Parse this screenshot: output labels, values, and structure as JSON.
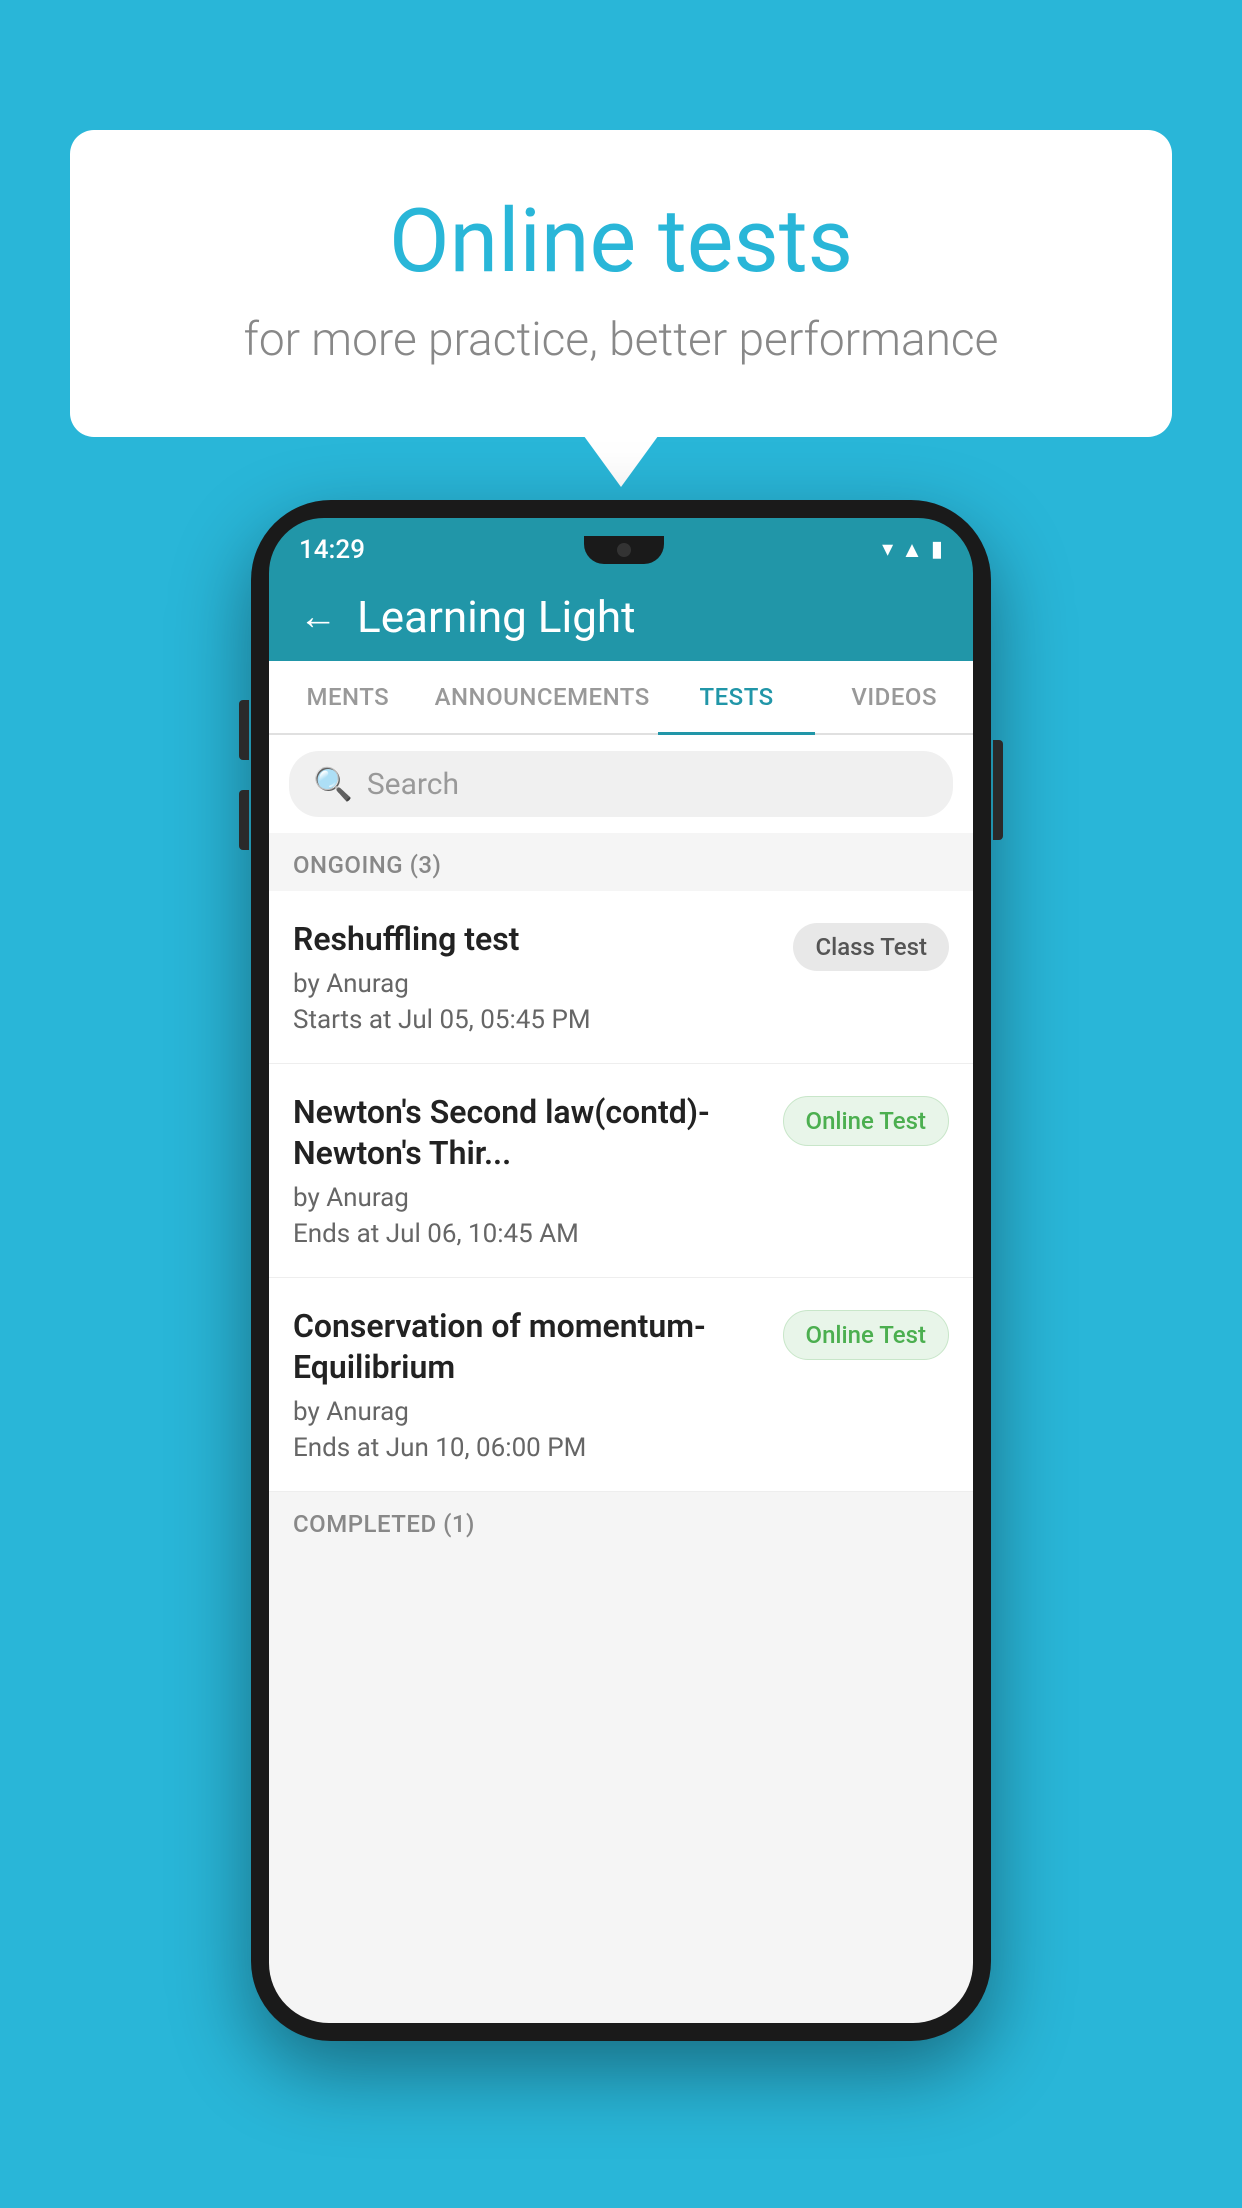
{
  "background_color": "#29b6d8",
  "speech_bubble": {
    "title": "Online tests",
    "subtitle": "for more practice, better performance"
  },
  "phone": {
    "time": "14:29",
    "app": {
      "title": "Learning Light",
      "back_label": "←"
    },
    "tabs": [
      {
        "id": "ments",
        "label": "MENTS",
        "active": false
      },
      {
        "id": "announcements",
        "label": "ANNOUNCEMENTS",
        "active": false
      },
      {
        "id": "tests",
        "label": "TESTS",
        "active": true
      },
      {
        "id": "videos",
        "label": "VIDEOS",
        "active": false
      }
    ],
    "search": {
      "placeholder": "Search"
    },
    "sections": [
      {
        "title": "ONGOING (3)",
        "items": [
          {
            "name": "Reshuffling test",
            "author": "by Anurag",
            "date": "Starts at  Jul 05, 05:45 PM",
            "badge": "Class Test",
            "badge_type": "class"
          },
          {
            "name": "Newton's Second law(contd)-Newton's Thir...",
            "author": "by Anurag",
            "date": "Ends at  Jul 06, 10:45 AM",
            "badge": "Online Test",
            "badge_type": "online"
          },
          {
            "name": "Conservation of momentum-Equilibrium",
            "author": "by Anurag",
            "date": "Ends at  Jun 10, 06:00 PM",
            "badge": "Online Test",
            "badge_type": "online"
          }
        ]
      },
      {
        "title": "COMPLETED (1)",
        "items": []
      }
    ]
  }
}
